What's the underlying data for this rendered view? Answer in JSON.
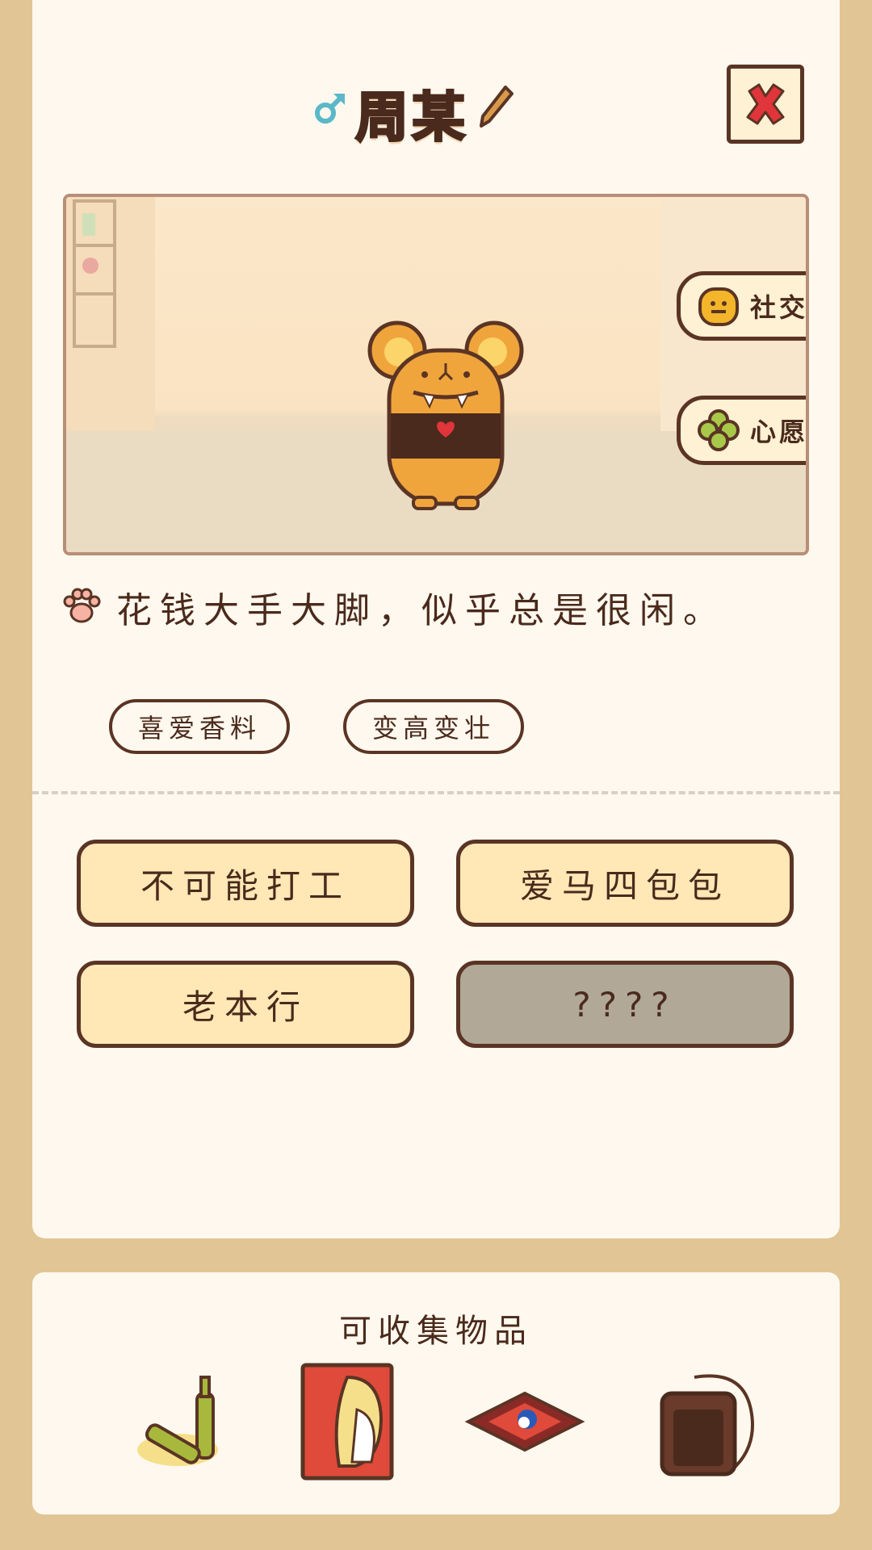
{
  "header": {
    "gender_symbol": "♂",
    "name": "周某",
    "close_label": "close"
  },
  "scene": {
    "tabs": [
      {
        "label": "社交",
        "icon": "social-face-icon"
      },
      {
        "label": "心愿",
        "icon": "clover-icon"
      }
    ]
  },
  "description": "花钱大手大脚，似乎总是很闲。",
  "tags": [
    "喜爱香料",
    "变高变壮"
  ],
  "traits": [
    {
      "label": "不可能打工",
      "locked": false
    },
    {
      "label": "爱马四包包",
      "locked": false
    },
    {
      "label": "老本行",
      "locked": false
    },
    {
      "label": "????",
      "locked": true
    }
  ],
  "collectibles": {
    "title": "可收集物品",
    "items": [
      "bottles-icon",
      "super-poster-icon",
      "carpet-icon",
      "backpack-icon"
    ]
  },
  "colors": {
    "background": "#e2c595",
    "card": "#fef8ee",
    "outline": "#5a3424",
    "button": "#ffe8b6",
    "locked": "#b1a898",
    "close_x": "#e0353a",
    "gender": "#5ab8c8"
  }
}
